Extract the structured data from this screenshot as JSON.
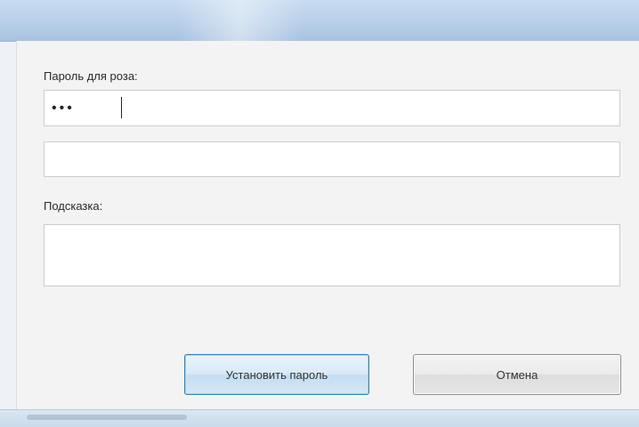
{
  "window": {
    "title": ""
  },
  "form": {
    "password_label": "Пароль для роза:",
    "password_value": "•••",
    "confirm_value": "",
    "hint_label": "Подсказка:",
    "hint_value": ""
  },
  "buttons": {
    "set_password_label": "Установить пароль",
    "cancel_label": "Отмена"
  },
  "colors": {
    "titlebar": "#b8cfe8",
    "client_bg": "#f3f3f3",
    "primary_border": "#3c7fb1"
  }
}
